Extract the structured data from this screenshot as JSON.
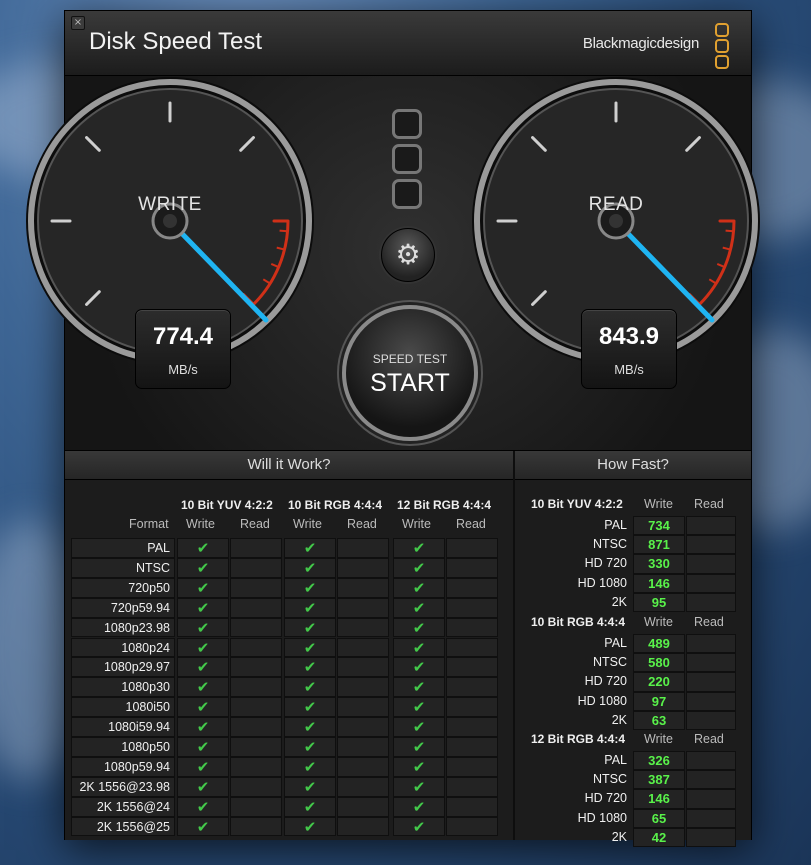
{
  "app": {
    "title": "Disk Speed Test",
    "brand": "Blackmagicdesign",
    "close_glyph": "×"
  },
  "gauges": {
    "write": {
      "label": "WRITE",
      "value": "774.4",
      "unit": "MB/s"
    },
    "read": {
      "label": "READ",
      "value": "843.9",
      "unit": "MB/s"
    }
  },
  "controls": {
    "settings_icon": "gear-icon",
    "settings_glyph": "⚙",
    "start_small": "SPEED TEST",
    "start_big": "START"
  },
  "will_it_work": {
    "title": "Will it Work?",
    "format_header": "Format",
    "groups": [
      "10 Bit YUV 4:2:2",
      "10 Bit RGB 4:4:4",
      "12 Bit RGB 4:4:4"
    ],
    "col_write": "Write",
    "col_read": "Read",
    "check_glyph": "✔",
    "formats": [
      "PAL",
      "NTSC",
      "720p50",
      "720p59.94",
      "1080p23.98",
      "1080p24",
      "1080p29.97",
      "1080p30",
      "1080i50",
      "1080i59.94",
      "1080p50",
      "1080p59.94",
      "2K 1556@23.98",
      "2K 1556@24",
      "2K 1556@25"
    ]
  },
  "how_fast": {
    "title": "How Fast?",
    "col_write": "Write",
    "col_read": "Read",
    "sections": [
      {
        "name": "10 Bit YUV 4:2:2",
        "rows": [
          {
            "format": "PAL",
            "write": "734"
          },
          {
            "format": "NTSC",
            "write": "871"
          },
          {
            "format": "HD 720",
            "write": "330"
          },
          {
            "format": "HD 1080",
            "write": "146"
          },
          {
            "format": "2K",
            "write": "95"
          }
        ]
      },
      {
        "name": "10 Bit RGB 4:4:4",
        "rows": [
          {
            "format": "PAL",
            "write": "489"
          },
          {
            "format": "NTSC",
            "write": "580"
          },
          {
            "format": "HD 720",
            "write": "220"
          },
          {
            "format": "HD 1080",
            "write": "97"
          },
          {
            "format": "2K",
            "write": "63"
          }
        ]
      },
      {
        "name": "12 Bit RGB 4:4:4",
        "rows": [
          {
            "format": "PAL",
            "write": "326"
          },
          {
            "format": "NTSC",
            "write": "387"
          },
          {
            "format": "HD 720",
            "write": "146"
          },
          {
            "format": "HD 1080",
            "write": "65"
          },
          {
            "format": "2K",
            "write": "42"
          }
        ]
      }
    ]
  },
  "colors": {
    "needle": "#1fb4f2",
    "check": "#43c84a",
    "number": "#59f24a",
    "redline": "#d03018",
    "brand_accent": "#e0a030"
  }
}
